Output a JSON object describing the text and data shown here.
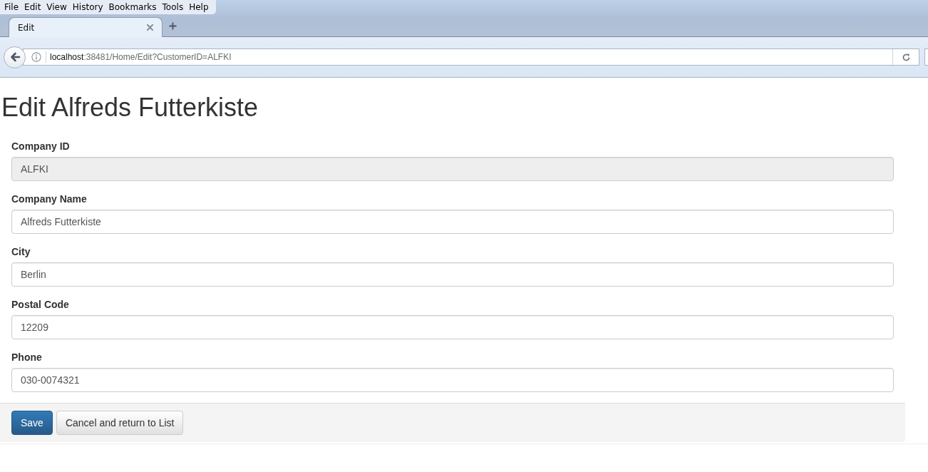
{
  "browser": {
    "menu": [
      "File",
      "Edit",
      "View",
      "History",
      "Bookmarks",
      "Tools",
      "Help"
    ],
    "tabs": [
      {
        "label": "Edit",
        "selected": true
      }
    ],
    "url": {
      "host": "localhost",
      "path": ":38481/Home/Edit?CustomerID=ALFKI"
    }
  },
  "page": {
    "heading": "Edit Alfreds Futterkiste",
    "fields": [
      {
        "label": "Company ID",
        "value": "ALFKI",
        "readonly": true
      },
      {
        "label": "Company Name",
        "value": "Alfreds Futterkiste",
        "readonly": false
      },
      {
        "label": "City",
        "value": "Berlin",
        "readonly": false
      },
      {
        "label": "Postal Code",
        "value": "12209",
        "readonly": false
      },
      {
        "label": "Phone",
        "value": "030-0074321",
        "readonly": false
      }
    ],
    "buttons": [
      {
        "label": "Save",
        "kind": "primary"
      },
      {
        "label": "Cancel and return to List",
        "kind": "default"
      }
    ]
  }
}
